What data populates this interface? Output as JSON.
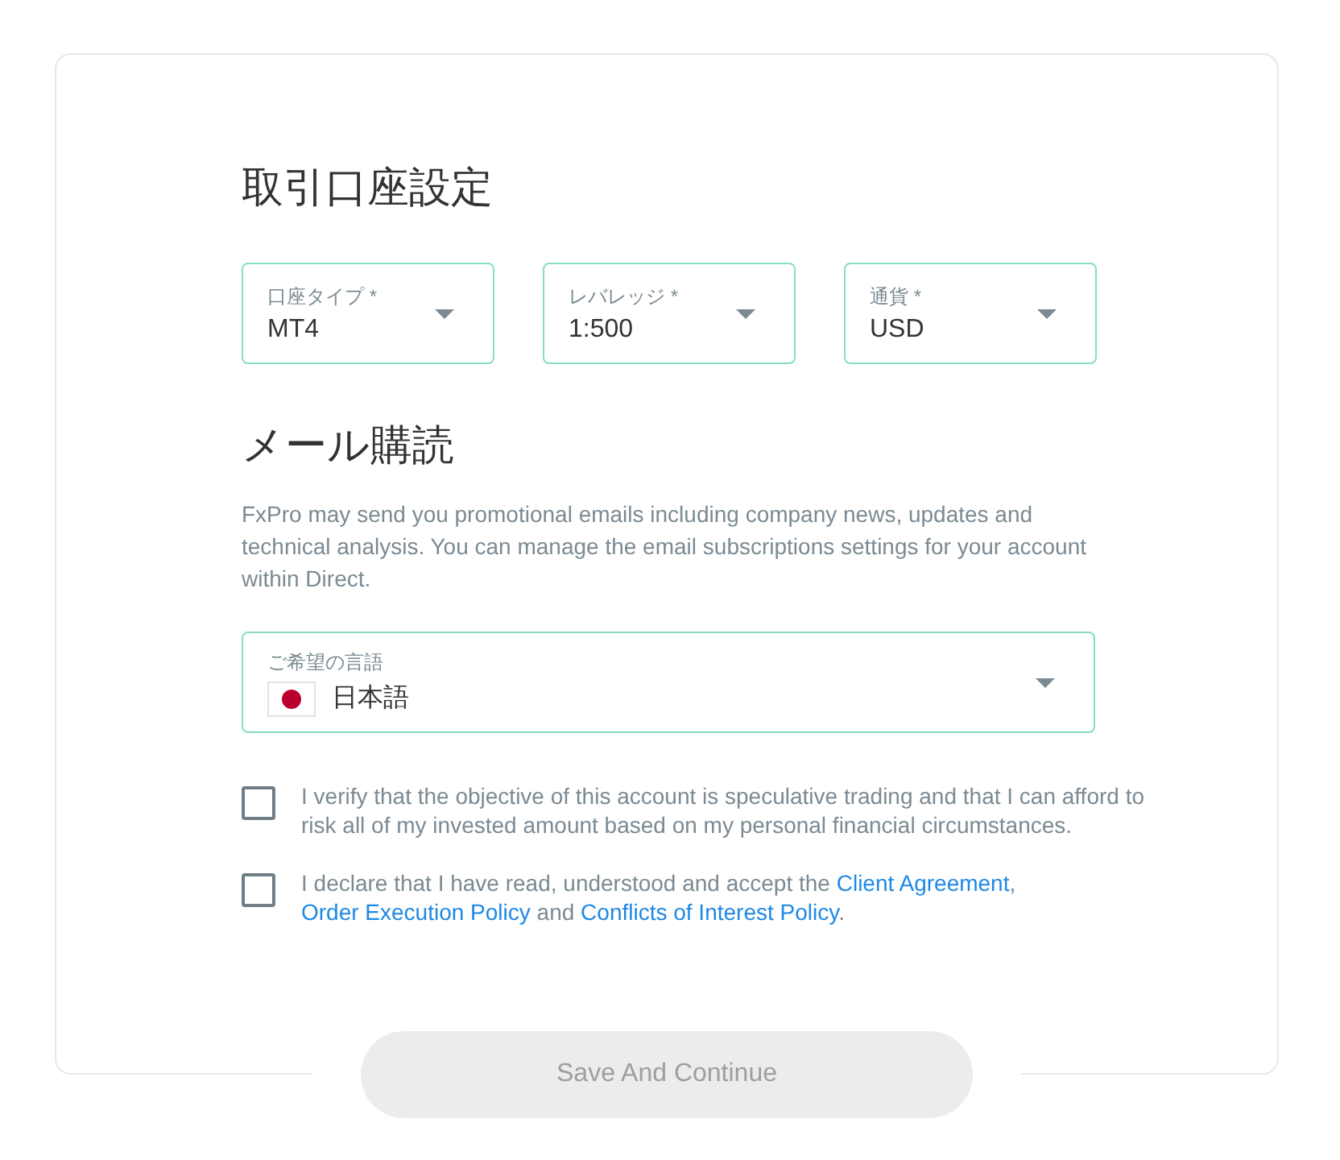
{
  "account_settings": {
    "title": "取引口座設定",
    "selects": [
      {
        "label": "口座タイプ *",
        "value": "MT4"
      },
      {
        "label": "レバレッジ *",
        "value": "1:500"
      },
      {
        "label": "通貨 *",
        "value": "USD"
      }
    ]
  },
  "email_subscription": {
    "title": "メール購読",
    "description": "FxPro may send you promotional emails including company news, updates and technical analysis. You can manage the email subscriptions settings for your account within Direct.",
    "language_select": {
      "label": "ご希望の言語",
      "value": "日本語"
    }
  },
  "agreements": [
    {
      "checked": false,
      "parts": [
        {
          "kind": "text",
          "text": "I verify that the objective of this account is speculative trading and that I can afford to risk all of my invested amount based on my personal financial circumstances."
        }
      ]
    },
    {
      "checked": false,
      "parts": [
        {
          "kind": "text",
          "text": "I declare that I have read, understood and accept the "
        },
        {
          "kind": "link",
          "text": "Client Agreement"
        },
        {
          "kind": "text",
          "text": ", "
        },
        {
          "kind": "link",
          "text": "Order Execution Policy"
        },
        {
          "kind": "text",
          "text": " and "
        },
        {
          "kind": "link",
          "text": "Conflicts of Interest Policy"
        },
        {
          "kind": "text",
          "text": "."
        }
      ]
    }
  ],
  "save_button": {
    "label": "Save And Continue",
    "disabled": true
  }
}
